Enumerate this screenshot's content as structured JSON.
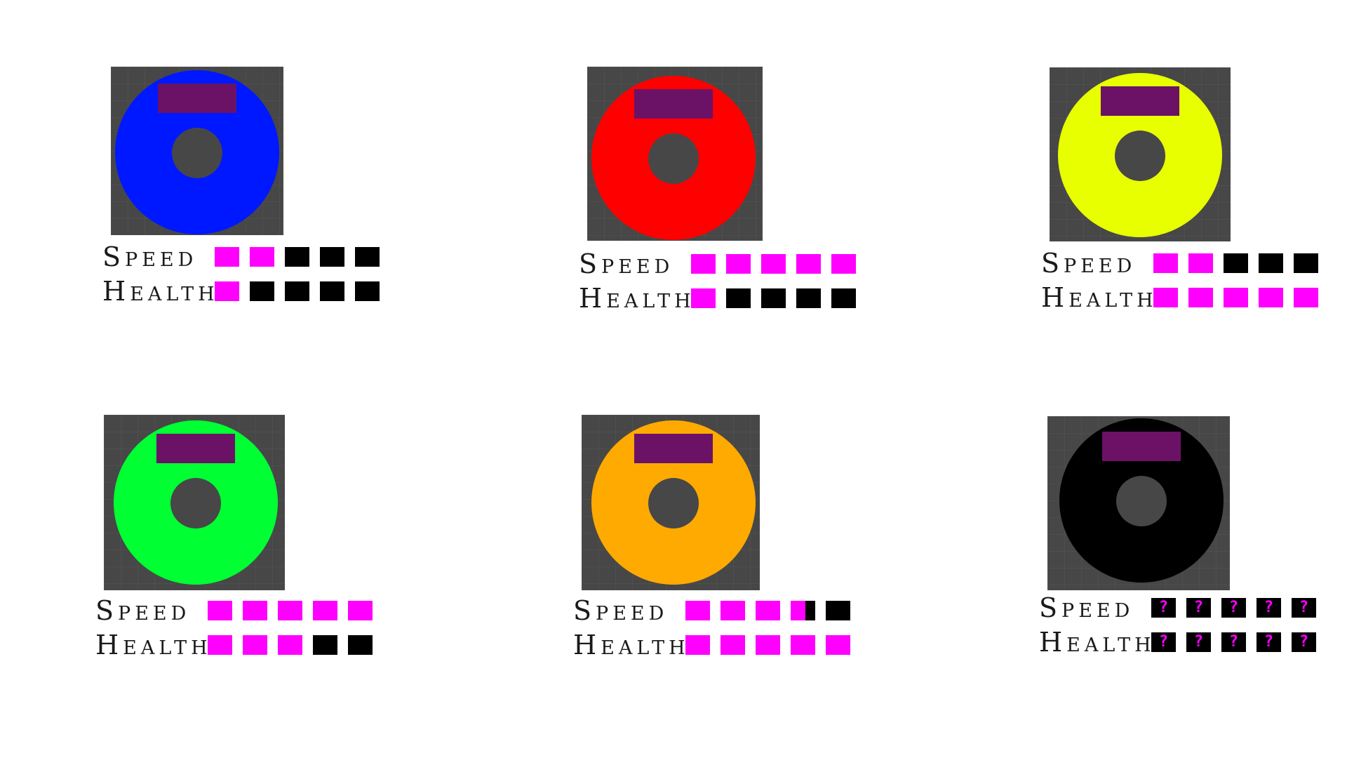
{
  "colors": {
    "filled": "#ff00ff",
    "empty": "#000000",
    "unknown_text": "#ff00ff"
  },
  "discs": [
    {
      "color": "#0018ff",
      "speed_label": "Speed",
      "health_label": "Health",
      "speed": 2,
      "health": 1,
      "unknown": false
    },
    {
      "color": "#ff0000",
      "speed_label": "Speed",
      "health_label": "Health",
      "speed": 5,
      "health": 1,
      "unknown": false
    },
    {
      "color": "#e8ff00",
      "speed_label": "Speed",
      "health_label": "Health",
      "speed": 2,
      "health": 5,
      "unknown": false
    },
    {
      "color": "#00ff33",
      "speed_label": "Speed",
      "health_label": "Health",
      "speed": 5,
      "health": 3,
      "unknown": false
    },
    {
      "color": "#ffaa00",
      "speed_label": "Speed",
      "health_label": "Health",
      "speed": 3.6,
      "health": 5,
      "unknown": false
    },
    {
      "color": "#000000",
      "speed_label": "Speed",
      "health_label": "Health",
      "speed": 0,
      "health": 0,
      "unknown": true,
      "unknown_symbol": "?"
    }
  ]
}
